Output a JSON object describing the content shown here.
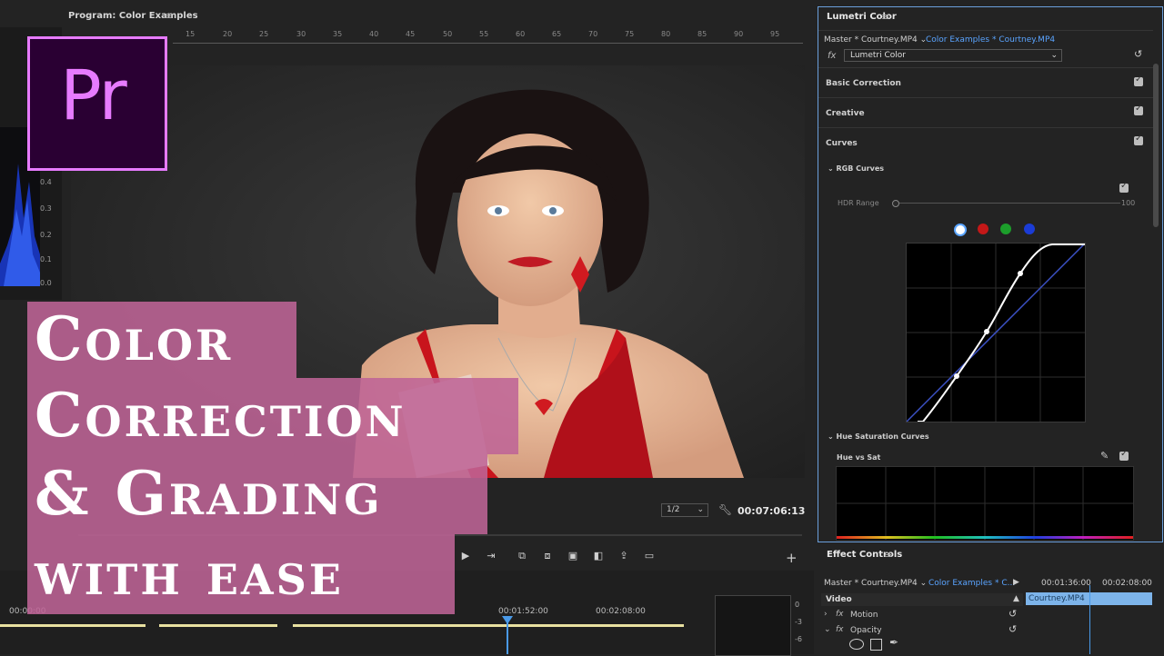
{
  "program": {
    "title": "Program: Color Examples",
    "menu_glyph": "≡",
    "ruler_labels": [
      "15",
      "20",
      "25",
      "30",
      "35",
      "40",
      "45",
      "50",
      "55",
      "60",
      "65",
      "70",
      "75",
      "80",
      "85",
      "90",
      "95"
    ],
    "zoom": "1/2",
    "timecode": "00:07:06:13"
  },
  "scope": {
    "ticks": [
      "0.4",
      "0.3",
      "0.2",
      "0.1",
      "0.0"
    ]
  },
  "timeline": {
    "times": [
      "00:00:00",
      "00:01:52:00",
      "00:02:08:00"
    ],
    "meter": [
      "0",
      "-3",
      "-6"
    ]
  },
  "lumetri": {
    "title": "Lumetri Color",
    "menu_glyph": "≡",
    "master_clip": "Master * Courtney.MP4",
    "seq_clip": "Color Examples * Courtney.MP4",
    "fx": "fx",
    "effect": "Lumetri Color",
    "sections": {
      "basic": "Basic Correction",
      "creative": "Creative",
      "curves": "Curves",
      "rgb_curves": "RGB Curves",
      "hdr_range": "HDR Range",
      "hdr_value": "100",
      "hue_sat_curves": "Hue Saturation Curves",
      "hue_vs_sat": "Hue vs Sat"
    },
    "channels": [
      {
        "name": "white",
        "color": "#ffffff"
      },
      {
        "name": "red",
        "color": "#c41818"
      },
      {
        "name": "green",
        "color": "#1c9e2b"
      },
      {
        "name": "blue",
        "color": "#1b3cd6"
      }
    ]
  },
  "effect_controls": {
    "title": "Effect Controls",
    "menu_glyph": "≡",
    "master_clip": "Master * Courtney.MP4",
    "seq_clip": "Color Examples * C...",
    "time_1": "00:01:36:00",
    "time_2": "00:02:08:00",
    "video_label": "Video",
    "motion": "Motion",
    "opacity": "Opacity",
    "clip_name": "Courtney.MP4"
  },
  "logo": {
    "text": "Pr"
  },
  "overlay": {
    "line1": "Color",
    "line2": "Correction",
    "line3": "& Grading",
    "line4": "with ease"
  },
  "colors": {
    "accent_blue": "#5aa4ff",
    "overlay_pink": "#be6496",
    "logo_purple": "#e77bff"
  }
}
